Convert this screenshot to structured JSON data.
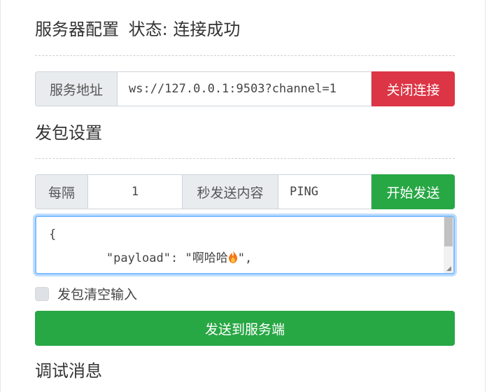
{
  "server_config": {
    "title": "服务器配置",
    "status_label": "状态:",
    "status_value": "连接成功",
    "address_label": "服务地址",
    "address_value": "ws://127.0.0.1:9503?channel=1",
    "close_button": "关闭连接"
  },
  "packet_settings": {
    "title": "发包设置",
    "interval_label": "每隔",
    "interval_value": "1",
    "seconds_label": "秒发送内容",
    "content_value": "PING",
    "start_button": "开始发送"
  },
  "payload_editor": {
    "line1": "{",
    "line2_prefix": "        \"payload\": \"啊哈哈",
    "line2_suffix": "\","
  },
  "clear_option": {
    "label": "发包清空输入",
    "checked": false
  },
  "send_button": "发送到服务端",
  "debug": {
    "title": "调试消息"
  },
  "colors": {
    "danger": "#dc3545",
    "success": "#28a745",
    "focus": "#80bdff"
  }
}
